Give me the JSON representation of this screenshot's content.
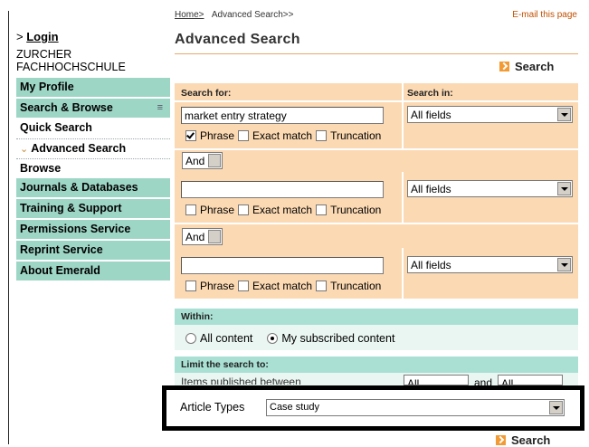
{
  "breadcrumb": {
    "home": "Home>",
    "current": "Advanced Search>>"
  },
  "email_link": "E-mail this page",
  "login": {
    "prefix": ">",
    "label": "Login"
  },
  "institution": "ZURCHER FACHHOCHSCHULE",
  "sidebar": {
    "items": [
      {
        "label": "My Profile"
      },
      {
        "label": "Search & Browse"
      },
      {
        "label": "Quick Search"
      },
      {
        "label": "Advanced Search"
      },
      {
        "label": "Browse"
      },
      {
        "label": "Journals & Databases"
      },
      {
        "label": "Training & Support"
      },
      {
        "label": "Permissions Service"
      },
      {
        "label": "Reprint Service"
      },
      {
        "label": "About Emerald"
      }
    ]
  },
  "page_title": "Advanced Search",
  "search_button_label": "Search",
  "form": {
    "search_for_header": "Search for:",
    "search_in_header": "Search in:",
    "rows": [
      {
        "query": "market entry strategy",
        "field": "All fields",
        "phrase_checked": true
      },
      {
        "query": "",
        "field": "All fields",
        "phrase_checked": false
      },
      {
        "query": "",
        "field": "All fields",
        "phrase_checked": false
      }
    ],
    "operators": [
      "And",
      "And"
    ],
    "options": {
      "phrase": "Phrase",
      "exact": "Exact match",
      "truncation": "Truncation"
    }
  },
  "within": {
    "header": "Within:",
    "options": [
      "All content",
      "My subscribed content"
    ],
    "selected": "My subscribed content"
  },
  "limit": {
    "header": "Limit the search to:",
    "items_published_label": "Items published between",
    "from": "All",
    "and_label": "and",
    "to": "All",
    "article_types_label": "Article Types",
    "article_type_value": "Case study"
  },
  "colors": {
    "teal": "#9ed6c6",
    "peach": "#fbd9b3",
    "accent_orange": "#f29b35",
    "highlight_border": "#000000"
  }
}
